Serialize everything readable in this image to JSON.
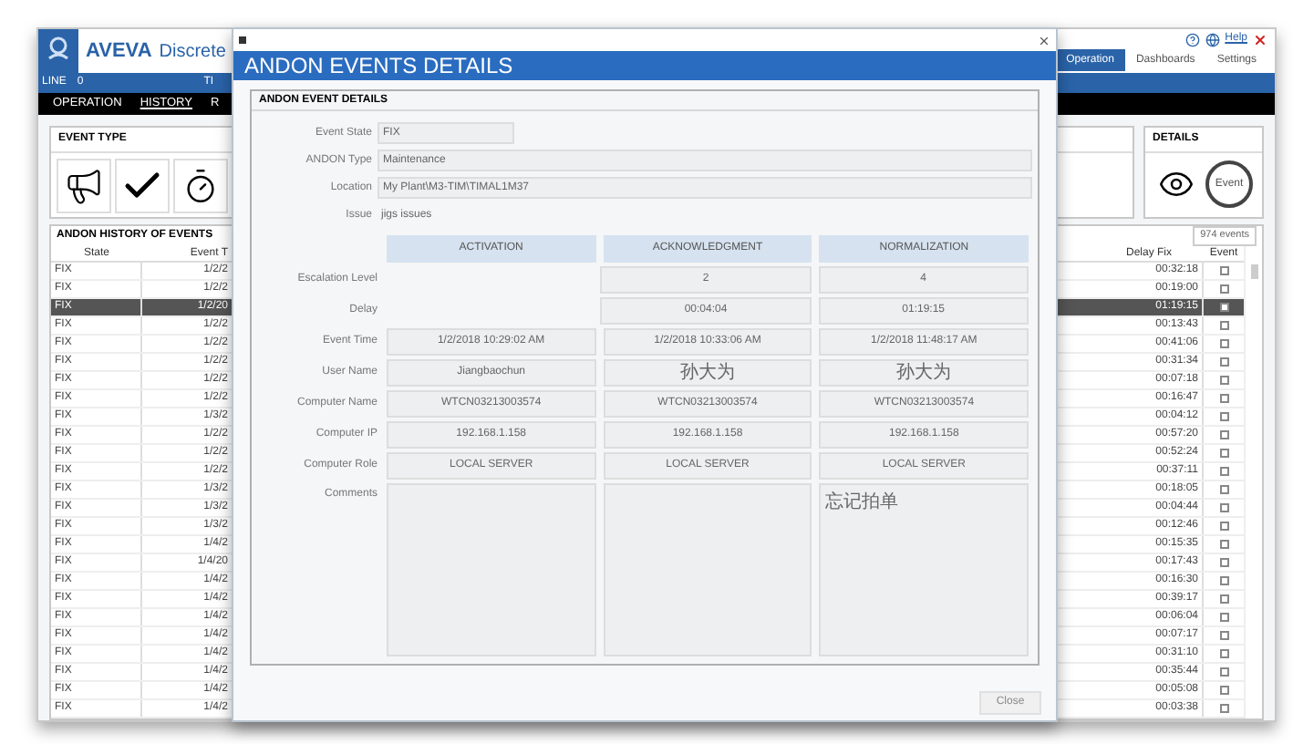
{
  "app": {
    "brand": "AVEVA",
    "title": "Discrete",
    "top_link": "Help",
    "tabs": [
      {
        "label": "Operation",
        "selected": true
      },
      {
        "label": "Dashboards",
        "selected": false
      },
      {
        "label": "Settings",
        "selected": false
      }
    ],
    "line_bar": {
      "label": "LINE",
      "count": "0",
      "cut_text": "TI"
    },
    "nav": [
      {
        "label": "OPERATION",
        "selected": false
      },
      {
        "label": "HISTORY",
        "selected": true
      },
      {
        "label": "R",
        "selected": false
      }
    ]
  },
  "event_type_panel": {
    "title": "EVENT TYPE"
  },
  "details_panel": {
    "title": "DETAILS",
    "event_button": "Event"
  },
  "history": {
    "title": "ANDON HISTORY OF EVENTS",
    "count": "974 events",
    "columns": [
      "State",
      "Event T",
      "Delay Fix",
      "Event"
    ],
    "rows": [
      {
        "state": "FIX",
        "event_time": "1/2/2",
        "delay_fix": "00:32:18",
        "selected": false
      },
      {
        "state": "FIX",
        "event_time": "1/2/2",
        "delay_fix": "00:19:00",
        "selected": false
      },
      {
        "state": "FIX",
        "event_time": "1/2/20",
        "delay_fix": "01:19:15",
        "selected": true
      },
      {
        "state": "FIX",
        "event_time": "1/2/2",
        "delay_fix": "00:13:43",
        "selected": false
      },
      {
        "state": "FIX",
        "event_time": "1/2/2",
        "delay_fix": "00:41:06",
        "selected": false
      },
      {
        "state": "FIX",
        "event_time": "1/2/2",
        "delay_fix": "00:31:34",
        "selected": false
      },
      {
        "state": "FIX",
        "event_time": "1/2/2",
        "delay_fix": "00:07:18",
        "selected": false
      },
      {
        "state": "FIX",
        "event_time": "1/2/2",
        "delay_fix": "00:16:47",
        "selected": false
      },
      {
        "state": "FIX",
        "event_time": "1/3/2",
        "delay_fix": "00:04:12",
        "selected": false
      },
      {
        "state": "FIX",
        "event_time": "1/2/2",
        "delay_fix": "00:57:20",
        "selected": false
      },
      {
        "state": "FIX",
        "event_time": "1/2/2",
        "delay_fix": "00:52:24",
        "selected": false
      },
      {
        "state": "FIX",
        "event_time": "1/2/2",
        "delay_fix": "00:37:11",
        "selected": false
      },
      {
        "state": "FIX",
        "event_time": "1/3/2",
        "delay_fix": "00:18:05",
        "selected": false
      },
      {
        "state": "FIX",
        "event_time": "1/3/2",
        "delay_fix": "00:04:44",
        "selected": false
      },
      {
        "state": "FIX",
        "event_time": "1/3/2",
        "delay_fix": "00:12:46",
        "selected": false
      },
      {
        "state": "FIX",
        "event_time": "1/4/2",
        "delay_fix": "00:15:35",
        "selected": false
      },
      {
        "state": "FIX",
        "event_time": "1/4/20",
        "delay_fix": "00:17:43",
        "selected": false
      },
      {
        "state": "FIX",
        "event_time": "1/4/2",
        "delay_fix": "00:16:30",
        "selected": false
      },
      {
        "state": "FIX",
        "event_time": "1/4/2",
        "delay_fix": "00:39:17",
        "selected": false
      },
      {
        "state": "FIX",
        "event_time": "1/4/2",
        "delay_fix": "00:06:04",
        "selected": false
      },
      {
        "state": "FIX",
        "event_time": "1/4/2",
        "delay_fix": "00:07:17",
        "selected": false
      },
      {
        "state": "FIX",
        "event_time": "1/4/2",
        "delay_fix": "00:31:10",
        "selected": false
      },
      {
        "state": "FIX",
        "event_time": "1/4/2",
        "delay_fix": "00:35:44",
        "selected": false
      },
      {
        "state": "FIX",
        "event_time": "1/4/2",
        "delay_fix": "00:05:08",
        "selected": false
      },
      {
        "state": "FIX",
        "event_time": "1/4/2",
        "delay_fix": "00:03:38",
        "selected": false
      }
    ]
  },
  "dialog": {
    "title": "ANDON EVENTS DETAILS",
    "panel_title": "ANDON EVENT DETAILS",
    "fields": [
      {
        "label": "Event State",
        "value": "FIX",
        "kind": "short"
      },
      {
        "label": "ANDON Type",
        "value": "Maintenance",
        "kind": "wide"
      },
      {
        "label": "Location",
        "value": "My Plant\\M3-TIM\\TIMAL1M37",
        "kind": "wide"
      },
      {
        "label": "Issue",
        "value": "jigs issues",
        "kind": "plain"
      }
    ],
    "columns": [
      "ACTIVATION",
      "ACKNOWLEDGMENT",
      "NORMALIZATION"
    ],
    "rows": [
      {
        "label": "Escalation Level",
        "kind": "line",
        "cells": [
          {
            "kind": "none"
          },
          {
            "kind": "field",
            "text": "2"
          },
          {
            "kind": "field",
            "text": "4"
          }
        ]
      },
      {
        "label": "Delay",
        "kind": "line",
        "cells": [
          {
            "kind": "none"
          },
          {
            "kind": "field",
            "text": "00:04:04"
          },
          {
            "kind": "field",
            "text": "01:19:15"
          }
        ]
      },
      {
        "label": "Event Time",
        "kind": "line",
        "cells": [
          {
            "kind": "field",
            "text": "1/2/2018 10:29:02 AM"
          },
          {
            "kind": "field",
            "text": "1/2/2018 10:33:06 AM"
          },
          {
            "kind": "field",
            "text": "1/2/2018 11:48:17 AM"
          }
        ]
      },
      {
        "label": "User Name",
        "kind": "line",
        "cells": [
          {
            "kind": "field",
            "text": "Jiangbaochun"
          },
          {
            "kind": "field",
            "text": "孙大为"
          },
          {
            "kind": "field",
            "text": "孙大为"
          }
        ]
      },
      {
        "label": "Computer Name",
        "kind": "line",
        "cells": [
          {
            "kind": "field",
            "text": "WTCN03213003574"
          },
          {
            "kind": "field",
            "text": "WTCN03213003574"
          },
          {
            "kind": "field",
            "text": "WTCN03213003574"
          }
        ]
      },
      {
        "label": "Computer IP",
        "kind": "line",
        "cells": [
          {
            "kind": "field",
            "text": "192.168.1.158"
          },
          {
            "kind": "field",
            "text": "192.168.1.158"
          },
          {
            "kind": "field",
            "text": "192.168.1.158"
          }
        ]
      },
      {
        "label": "Computer Role",
        "kind": "line",
        "cells": [
          {
            "kind": "field",
            "text": "LOCAL SERVER"
          },
          {
            "kind": "field",
            "text": "LOCAL SERVER"
          },
          {
            "kind": "field",
            "text": "LOCAL SERVER"
          }
        ]
      },
      {
        "label": "Comments",
        "kind": "area",
        "cells": [
          {
            "kind": "field"
          },
          {
            "kind": "field"
          },
          {
            "kind": "field",
            "text": "忘记拍单"
          }
        ]
      }
    ],
    "close_button": "Close"
  }
}
